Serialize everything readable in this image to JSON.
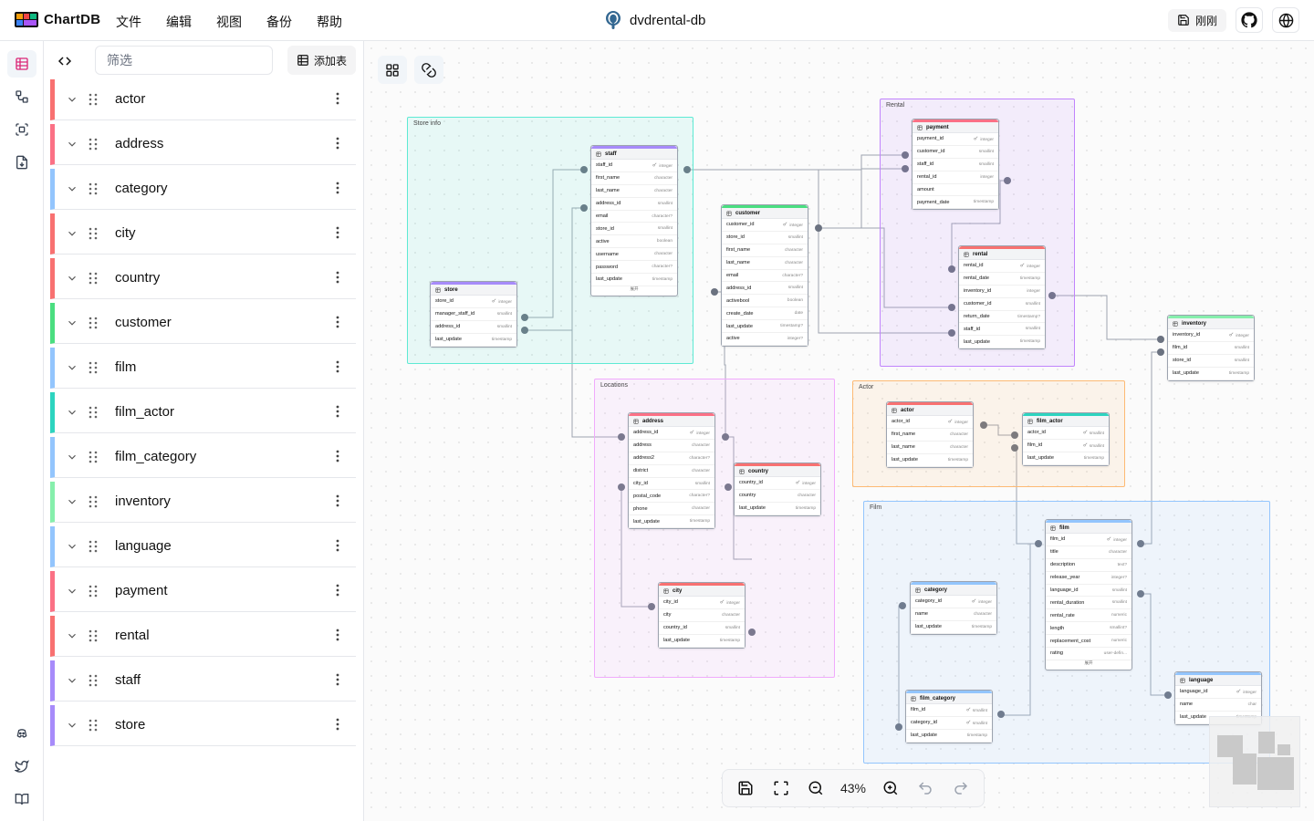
{
  "app": {
    "name": "ChartDB",
    "db_name": "dvdrental-db"
  },
  "menu": [
    "文件",
    "编辑",
    "视图",
    "备份",
    "帮助"
  ],
  "topbar": {
    "saved_label": "刚刚"
  },
  "sidebar": {
    "filter_placeholder": "筛选",
    "add_table_label": "添加表"
  },
  "tables_list": [
    {
      "name": "actor",
      "color": "#f87171"
    },
    {
      "name": "address",
      "color": "#fb7185"
    },
    {
      "name": "category",
      "color": "#93c5fd"
    },
    {
      "name": "city",
      "color": "#f87171"
    },
    {
      "name": "country",
      "color": "#f87171"
    },
    {
      "name": "customer",
      "color": "#4ade80"
    },
    {
      "name": "film",
      "color": "#93c5fd"
    },
    {
      "name": "film_actor",
      "color": "#2dd4bf"
    },
    {
      "name": "film_category",
      "color": "#93c5fd"
    },
    {
      "name": "inventory",
      "color": "#86efac"
    },
    {
      "name": "language",
      "color": "#93c5fd"
    },
    {
      "name": "payment",
      "color": "#fb7185"
    },
    {
      "name": "rental",
      "color": "#f87171"
    },
    {
      "name": "staff",
      "color": "#a78bfa"
    },
    {
      "name": "store",
      "color": "#a78bfa"
    }
  ],
  "areas": {
    "store_info": {
      "label": "Store info",
      "color": "#5eead4"
    },
    "rental": {
      "label": "Rental",
      "color": "#c084fc"
    },
    "locations": {
      "label": "Locations",
      "color": "#f0abfc"
    },
    "actor": {
      "label": "Actor",
      "color": "#fdba74"
    },
    "film": {
      "label": "Film",
      "color": "#93c5fd"
    }
  },
  "diagram": {
    "store": {
      "name": "store",
      "color": "#a78bfa",
      "fields": [
        {
          "name": "store_id",
          "type": "integer",
          "pk": true
        },
        {
          "name": "manager_staff_id",
          "type": "smallint",
          "pk": false
        },
        {
          "name": "address_id",
          "type": "smallint",
          "pk": false
        },
        {
          "name": "last_update",
          "type": "timestamp",
          "pk": false
        }
      ]
    },
    "staff": {
      "name": "staff",
      "color": "#a78bfa",
      "more": "展开",
      "fields": [
        {
          "name": "staff_id",
          "type": "integer",
          "pk": true
        },
        {
          "name": "first_name",
          "type": "character",
          "pk": false
        },
        {
          "name": "last_name",
          "type": "character",
          "pk": false
        },
        {
          "name": "address_id",
          "type": "smallint",
          "pk": false
        },
        {
          "name": "email",
          "type": "character?",
          "pk": false
        },
        {
          "name": "store_id",
          "type": "smallint",
          "pk": false
        },
        {
          "name": "active",
          "type": "boolean",
          "pk": false
        },
        {
          "name": "username",
          "type": "character",
          "pk": false
        },
        {
          "name": "password",
          "type": "character?",
          "pk": false
        },
        {
          "name": "last_update",
          "type": "timestamp",
          "pk": false
        }
      ]
    },
    "customer": {
      "name": "customer",
      "color": "#4ade80",
      "fields": [
        {
          "name": "customer_id",
          "type": "integer",
          "pk": true
        },
        {
          "name": "store_id",
          "type": "smallint",
          "pk": false
        },
        {
          "name": "first_name",
          "type": "character",
          "pk": false
        },
        {
          "name": "last_name",
          "type": "character",
          "pk": false
        },
        {
          "name": "email",
          "type": "character?",
          "pk": false
        },
        {
          "name": "address_id",
          "type": "smallint",
          "pk": false
        },
        {
          "name": "activebool",
          "type": "boolean",
          "pk": false
        },
        {
          "name": "create_date",
          "type": "date",
          "pk": false
        },
        {
          "name": "last_update",
          "type": "timestamp?",
          "pk": false
        },
        {
          "name": "active",
          "type": "integer?",
          "pk": false
        }
      ]
    },
    "payment": {
      "name": "payment",
      "color": "#fb7185",
      "fields": [
        {
          "name": "payment_id",
          "type": "integer",
          "pk": true
        },
        {
          "name": "customer_id",
          "type": "smallint",
          "pk": false
        },
        {
          "name": "staff_id",
          "type": "smallint",
          "pk": false
        },
        {
          "name": "rental_id",
          "type": "integer",
          "pk": false
        },
        {
          "name": "amount",
          "type": "",
          "pk": false
        },
        {
          "name": "payment_date",
          "type": "timestamp",
          "pk": false
        }
      ]
    },
    "rental": {
      "name": "rental",
      "color": "#f87171",
      "fields": [
        {
          "name": "rental_id",
          "type": "integer",
          "pk": true
        },
        {
          "name": "rental_date",
          "type": "timestamp",
          "pk": false
        },
        {
          "name": "inventory_id",
          "type": "integer",
          "pk": false
        },
        {
          "name": "customer_id",
          "type": "smallint",
          "pk": false
        },
        {
          "name": "return_date",
          "type": "timestamp?",
          "pk": false
        },
        {
          "name": "staff_id",
          "type": "smallint",
          "pk": false
        },
        {
          "name": "last_update",
          "type": "timestamp",
          "pk": false
        }
      ]
    },
    "inventory": {
      "name": "inventory",
      "color": "#86efac",
      "fields": [
        {
          "name": "inventory_id",
          "type": "integer",
          "pk": true
        },
        {
          "name": "film_id",
          "type": "smallint",
          "pk": false
        },
        {
          "name": "store_id",
          "type": "smallint",
          "pk": false
        },
        {
          "name": "last_update",
          "type": "timestamp",
          "pk": false
        }
      ]
    },
    "address": {
      "name": "address",
      "color": "#fb7185",
      "fields": [
        {
          "name": "address_id",
          "type": "integer",
          "pk": true
        },
        {
          "name": "address",
          "type": "character",
          "pk": false
        },
        {
          "name": "address2",
          "type": "character?",
          "pk": false
        },
        {
          "name": "district",
          "type": "character",
          "pk": false
        },
        {
          "name": "city_id",
          "type": "smallint",
          "pk": false
        },
        {
          "name": "postal_code",
          "type": "character?",
          "pk": false
        },
        {
          "name": "phone",
          "type": "character",
          "pk": false
        },
        {
          "name": "last_update",
          "type": "timestamp",
          "pk": false
        }
      ]
    },
    "country": {
      "name": "country",
      "color": "#f87171",
      "fields": [
        {
          "name": "country_id",
          "type": "integer",
          "pk": true
        },
        {
          "name": "country",
          "type": "character",
          "pk": false
        },
        {
          "name": "last_update",
          "type": "timestamp",
          "pk": false
        }
      ]
    },
    "city": {
      "name": "city",
      "color": "#f87171",
      "fields": [
        {
          "name": "city_id",
          "type": "integer",
          "pk": true
        },
        {
          "name": "city",
          "type": "character",
          "pk": false
        },
        {
          "name": "country_id",
          "type": "smallint",
          "pk": false
        },
        {
          "name": "last_update",
          "type": "timestamp",
          "pk": false
        }
      ]
    },
    "actor": {
      "name": "actor",
      "color": "#f87171",
      "fields": [
        {
          "name": "actor_id",
          "type": "integer",
          "pk": true
        },
        {
          "name": "first_name",
          "type": "character",
          "pk": false
        },
        {
          "name": "last_name",
          "type": "character",
          "pk": false
        },
        {
          "name": "last_update",
          "type": "timestamp",
          "pk": false
        }
      ]
    },
    "film_actor": {
      "name": "film_actor",
      "color": "#2dd4bf",
      "fields": [
        {
          "name": "actor_id",
          "type": "smallint",
          "pk": true
        },
        {
          "name": "film_id",
          "type": "smallint",
          "pk": true
        },
        {
          "name": "last_update",
          "type": "timestamp",
          "pk": false
        }
      ]
    },
    "film": {
      "name": "film",
      "color": "#93c5fd",
      "more": "展开",
      "fields": [
        {
          "name": "film_id",
          "type": "integer",
          "pk": true
        },
        {
          "name": "title",
          "type": "character",
          "pk": false
        },
        {
          "name": "description",
          "type": "text?",
          "pk": false
        },
        {
          "name": "release_year",
          "type": "integer?",
          "pk": false
        },
        {
          "name": "language_id",
          "type": "smallint",
          "pk": false
        },
        {
          "name": "rental_duration",
          "type": "smallint",
          "pk": false
        },
        {
          "name": "rental_rate",
          "type": "numeric",
          "pk": false
        },
        {
          "name": "length",
          "type": "smallint?",
          "pk": false
        },
        {
          "name": "replacement_cost",
          "type": "numeric",
          "pk": false
        },
        {
          "name": "rating",
          "type": "user-defin...",
          "pk": false
        }
      ]
    },
    "category": {
      "name": "category",
      "color": "#93c5fd",
      "fields": [
        {
          "name": "category_id",
          "type": "integer",
          "pk": true
        },
        {
          "name": "name",
          "type": "character",
          "pk": false
        },
        {
          "name": "last_update",
          "type": "timestamp",
          "pk": false
        }
      ]
    },
    "film_category": {
      "name": "film_category",
      "color": "#93c5fd",
      "fields": [
        {
          "name": "film_id",
          "type": "smallint",
          "pk": true
        },
        {
          "name": "category_id",
          "type": "smallint",
          "pk": true
        },
        {
          "name": "last_update",
          "type": "timestamp",
          "pk": false
        }
      ]
    },
    "language": {
      "name": "language",
      "color": "#93c5fd",
      "fields": [
        {
          "name": "language_id",
          "type": "integer",
          "pk": true
        },
        {
          "name": "name",
          "type": "char",
          "pk": false
        },
        {
          "name": "last_update",
          "type": "timestamp",
          "pk": false
        }
      ]
    }
  },
  "zoom": {
    "level": "43%"
  }
}
